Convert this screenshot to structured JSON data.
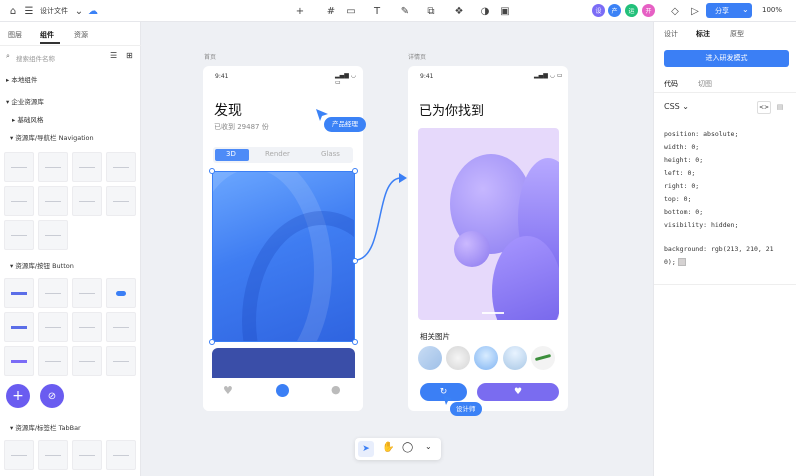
{
  "app": {
    "file_title": "设计文件",
    "zoom": "100%",
    "share_label": "分享"
  },
  "avatars": [
    {
      "text": "设",
      "color": "#7b6cf6"
    },
    {
      "text": "产",
      "color": "#3b82f6"
    },
    {
      "text": "运",
      "color": "#22c07a"
    },
    {
      "text": "开",
      "color": "#e660c4"
    }
  ],
  "left_panel": {
    "tabs": [
      "图层",
      "组件",
      "资源"
    ],
    "search_placeholder": "搜索组件名称",
    "sections": {
      "local": "本地组件",
      "enterprise": "企业资源库",
      "basic": "基础风格",
      "nav": "资源库/导航栏 Navigation",
      "button": "资源库/按钮 Button",
      "tabbar": "资源库/标签栏 TabBar"
    }
  },
  "canvas": {
    "frame1_label": "首页",
    "frame2_label": "详情页",
    "status_time": "9:41",
    "discover_title": "发现",
    "discover_sub": "已收到 29487 份",
    "seg_tabs": [
      "3D",
      "Render",
      "Glass"
    ],
    "found_title": "已为你找到",
    "related": "相关图片",
    "pm_tag": "产品经理",
    "designer_tag": "设计师"
  },
  "right_panel": {
    "tabs": [
      "设计",
      "标注",
      "原型"
    ],
    "dev_mode": "进入研发模式",
    "code_tabs": [
      "代码",
      "切图"
    ],
    "lang": "CSS",
    "code": {
      "l1": "position: absolute;",
      "l2": "width: 0;",
      "l3": "height: 0;",
      "l4": "left: 0;",
      "l5": "right: 0;",
      "l6": "top: 0;",
      "l7": "bottom: 0;",
      "l8": "visibility: hidden;",
      "l9": "background: rgb(213, 210, 21",
      "l10": "0);"
    }
  },
  "colors": {
    "accent": "#3b7ff5",
    "purple": "#7b6cf6"
  }
}
